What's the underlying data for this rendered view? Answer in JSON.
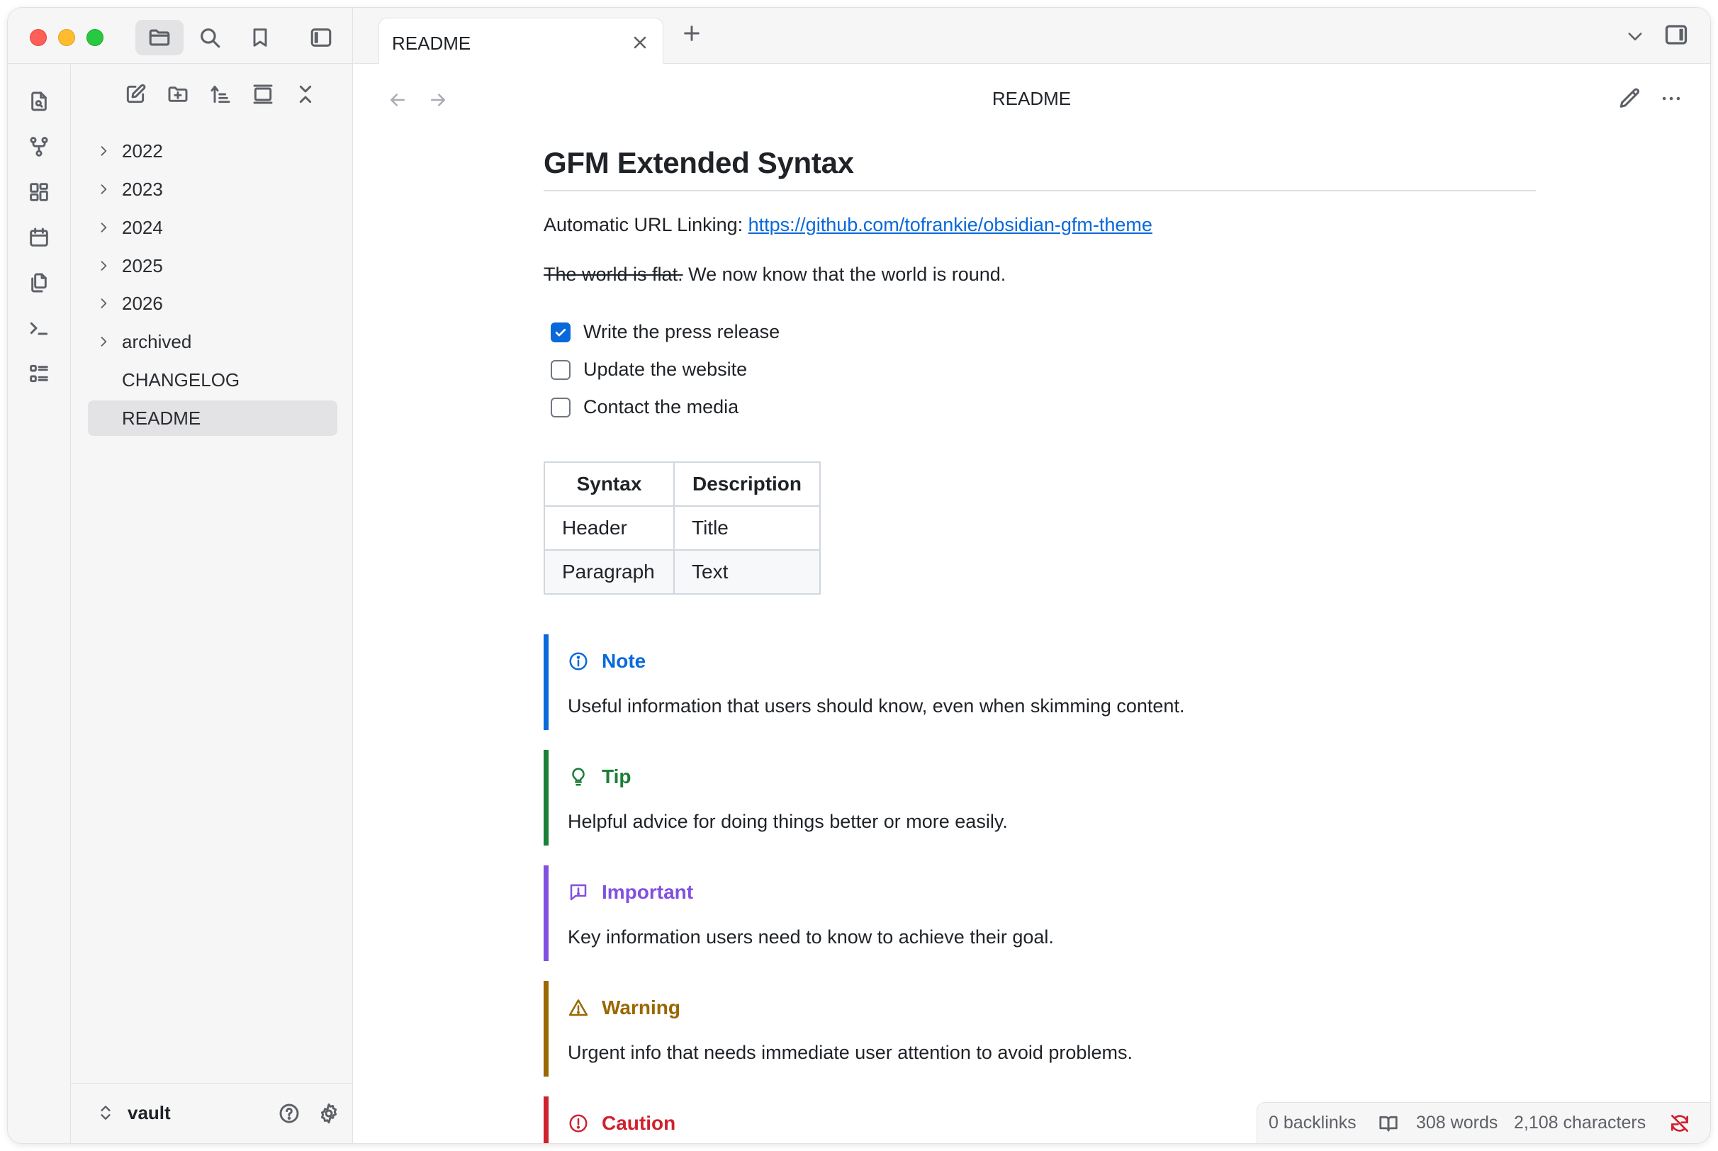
{
  "window": {
    "tab_title": "README",
    "view_title": "README"
  },
  "explorer": {
    "items": [
      {
        "label": "2022",
        "type": "folder"
      },
      {
        "label": "2023",
        "type": "folder"
      },
      {
        "label": "2024",
        "type": "folder"
      },
      {
        "label": "2025",
        "type": "folder"
      },
      {
        "label": "2026",
        "type": "folder"
      },
      {
        "label": "archived",
        "type": "folder"
      },
      {
        "label": "CHANGELOG",
        "type": "file"
      },
      {
        "label": "README",
        "type": "file",
        "selected": true
      }
    ],
    "vault_name": "vault"
  },
  "doc": {
    "heading": "GFM Extended Syntax",
    "url_label": "Automatic URL Linking: ",
    "url": "https://github.com/tofrankie/obsidian-gfm-theme",
    "strike_text": "The world is flat.",
    "after_strike": " We now know that the world is round.",
    "tasks": [
      {
        "label": "Write the press release",
        "checked": true
      },
      {
        "label": "Update the website",
        "checked": false
      },
      {
        "label": "Contact the media",
        "checked": false
      }
    ],
    "table": {
      "headers": [
        "Syntax",
        "Description"
      ],
      "rows": [
        [
          "Header",
          "Title"
        ],
        [
          "Paragraph",
          "Text"
        ]
      ]
    },
    "callouts": [
      {
        "title": "Note",
        "body": "Useful information that users should know, even when skimming content.",
        "color": "#0969da",
        "icon": "info-icon"
      },
      {
        "title": "Tip",
        "body": "Helpful advice for doing things better or more easily.",
        "color": "#1a7f37",
        "icon": "lightbulb-icon"
      },
      {
        "title": "Important",
        "body": "Key information users need to know to achieve their goal.",
        "color": "#8250df",
        "icon": "report-icon"
      },
      {
        "title": "Warning",
        "body": "Urgent info that needs immediate user attention to avoid problems.",
        "color": "#9a6700",
        "icon": "alert-icon"
      },
      {
        "title": "Caution",
        "body": "",
        "color": "#cf222e",
        "icon": "stop-icon"
      }
    ]
  },
  "status": {
    "backlinks": "0 backlinks",
    "words": "308 words",
    "characters": "2,108 characters"
  },
  "colors": {
    "link": "#0969da",
    "checkbox": "#0969da",
    "sync_error": "#cf222e"
  }
}
